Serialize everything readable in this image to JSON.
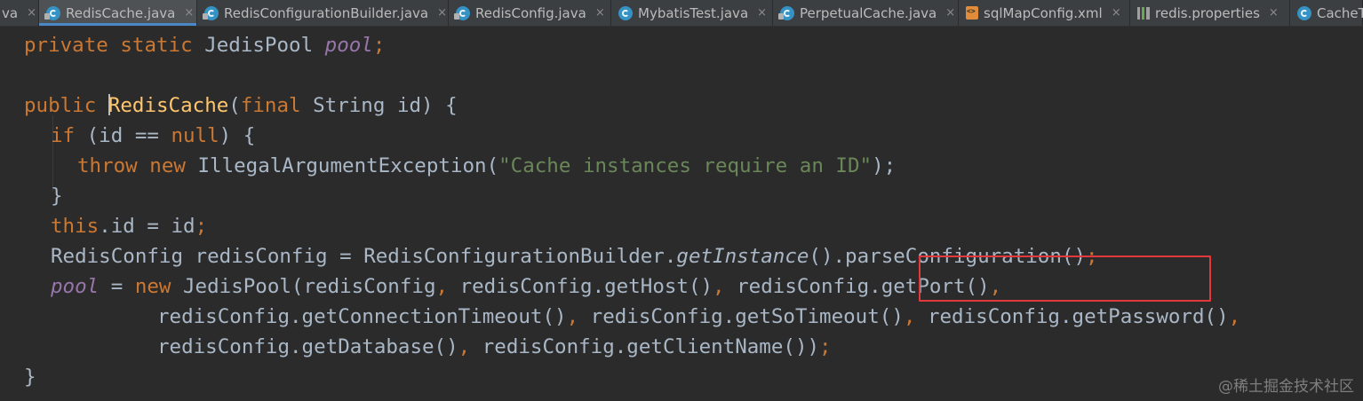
{
  "tabs": [
    {
      "label": "va",
      "icon": "",
      "active": false
    },
    {
      "label": "RedisCache.java",
      "icon": "java-class-icon",
      "active": true
    },
    {
      "label": "RedisConfigurationBuilder.java",
      "icon": "java-class-icon",
      "active": false
    },
    {
      "label": "RedisConfig.java",
      "icon": "java-class-icon",
      "active": false
    },
    {
      "label": "MybatisTest.java",
      "icon": "java-class-icon",
      "active": false
    },
    {
      "label": "PerpetualCache.java",
      "icon": "java-class-icon",
      "active": false
    },
    {
      "label": "sqlMapConfig.xml",
      "icon": "xml-file-icon",
      "active": false
    },
    {
      "label": "redis.properties",
      "icon": "properties-file-icon",
      "active": false
    },
    {
      "label": "CacheT",
      "icon": "java-class-icon",
      "active": false
    }
  ],
  "tab_close_glyph": "×",
  "code": {
    "l1": {
      "kw1": "private",
      "kw2": "static",
      "type": "JedisPool",
      "field": "pool",
      "end": ";"
    },
    "l3": {
      "kw": "public",
      "name": "RedisCache",
      "open": "(",
      "kw2": "final",
      "rest": "String id) {"
    },
    "l4": {
      "kw": "if",
      "a": " (id == ",
      "kw2": "null",
      "b": ") {"
    },
    "l5": {
      "kw": "throw",
      "kw2": "new",
      "cls": "IllegalArgumentException(",
      "str": "\"Cache instances require an ID\"",
      "end": ");"
    },
    "l6": {
      "text": "}"
    },
    "l7": {
      "kw": "this",
      "a": ".id = id",
      "end": ";"
    },
    "l8": {
      "a": "RedisConfig redisConfig = RedisConfigurationBuilder.",
      "it": "getInstance",
      "b": "()",
      "c": ".parseConfiguration()",
      "end": ";"
    },
    "l9": {
      "field": "pool",
      "a": " = ",
      "kw": "new",
      "b": " JedisPool(redisConfig",
      "c1": ",",
      "b2": " redisConfig.getHost()",
      "c2": ",",
      "b3": " redisConfig.getPort()",
      "c3": ","
    },
    "l10": {
      "a": "redisConfig.getConnectionTimeout()",
      "c1": ",",
      "b": " redisConfig.getSoTimeout()",
      "c2": ",",
      "d": " redisConfig.getPassword()",
      "c3": ","
    },
    "l11": {
      "a": "redisConfig.getDatabase()",
      "c1": ",",
      "b": " redisConfig.getClientName())",
      "end": ";"
    },
    "l12": {
      "text": "}"
    }
  },
  "watermark": "@稀土掘金技术社区",
  "colors": {
    "background": "#2b2b2b",
    "keyword": "#cc7832",
    "field": "#9876aa",
    "string": "#6a8759",
    "text": "#a9b7c6",
    "highlight_box": "#e4393c"
  }
}
